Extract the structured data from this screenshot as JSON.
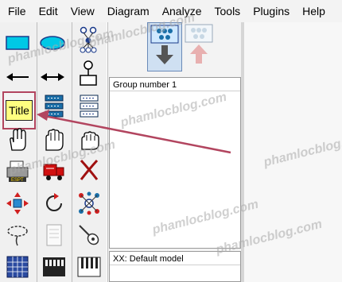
{
  "menu": [
    "File",
    "Edit",
    "View",
    "Diagram",
    "Analyze",
    "Tools",
    "Plugins",
    "Help"
  ],
  "palette": {
    "title_tool_label": "Title"
  },
  "panels": {
    "group_label": "Group number 1",
    "model_label": "XX: Default model"
  },
  "watermark": "phamlocblog.com",
  "colors": {
    "highlight": "#b2455f",
    "title_fill": "#ffff80",
    "shape_fill": "#00c8e6"
  }
}
